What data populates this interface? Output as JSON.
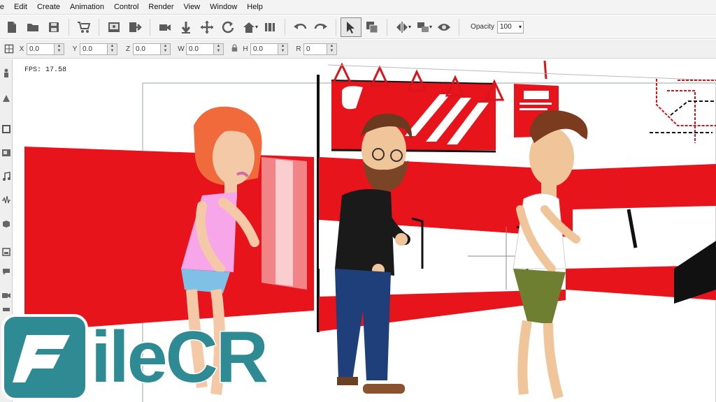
{
  "menu": [
    "ile",
    "Edit",
    "Create",
    "Animation",
    "Control",
    "Render",
    "View",
    "Window",
    "Help"
  ],
  "toolbar": {
    "icons": [
      "new-file-icon",
      "open-folder-icon",
      "save-icon",
      "cart-icon",
      "scene-icon",
      "export-icon",
      "camera-icon",
      "move-down-icon",
      "move-icon",
      "rotate-icon",
      "home-icon",
      "film-icon",
      "undo-icon",
      "redo-icon",
      "select-arrow-icon",
      "duplicate-icon",
      "flip-icon",
      "layers-icon",
      "eye-icon"
    ],
    "opacity_label": "Opacity",
    "opacity_value": "100"
  },
  "transform": {
    "fields": [
      {
        "label": "X",
        "value": "0.0"
      },
      {
        "label": "Y",
        "value": "0.0"
      },
      {
        "label": "Z",
        "value": "0.0"
      },
      {
        "label": "W",
        "value": "0.0"
      },
      {
        "label": "H",
        "value": "0.0"
      },
      {
        "label": "R",
        "value": "0"
      }
    ]
  },
  "canvas": {
    "fps_text": "FPS: 17.58"
  },
  "watermark": {
    "text": "ileCR"
  },
  "colors": {
    "scene_red": "#e8141b",
    "watermark_teal": "#2e8a93"
  }
}
